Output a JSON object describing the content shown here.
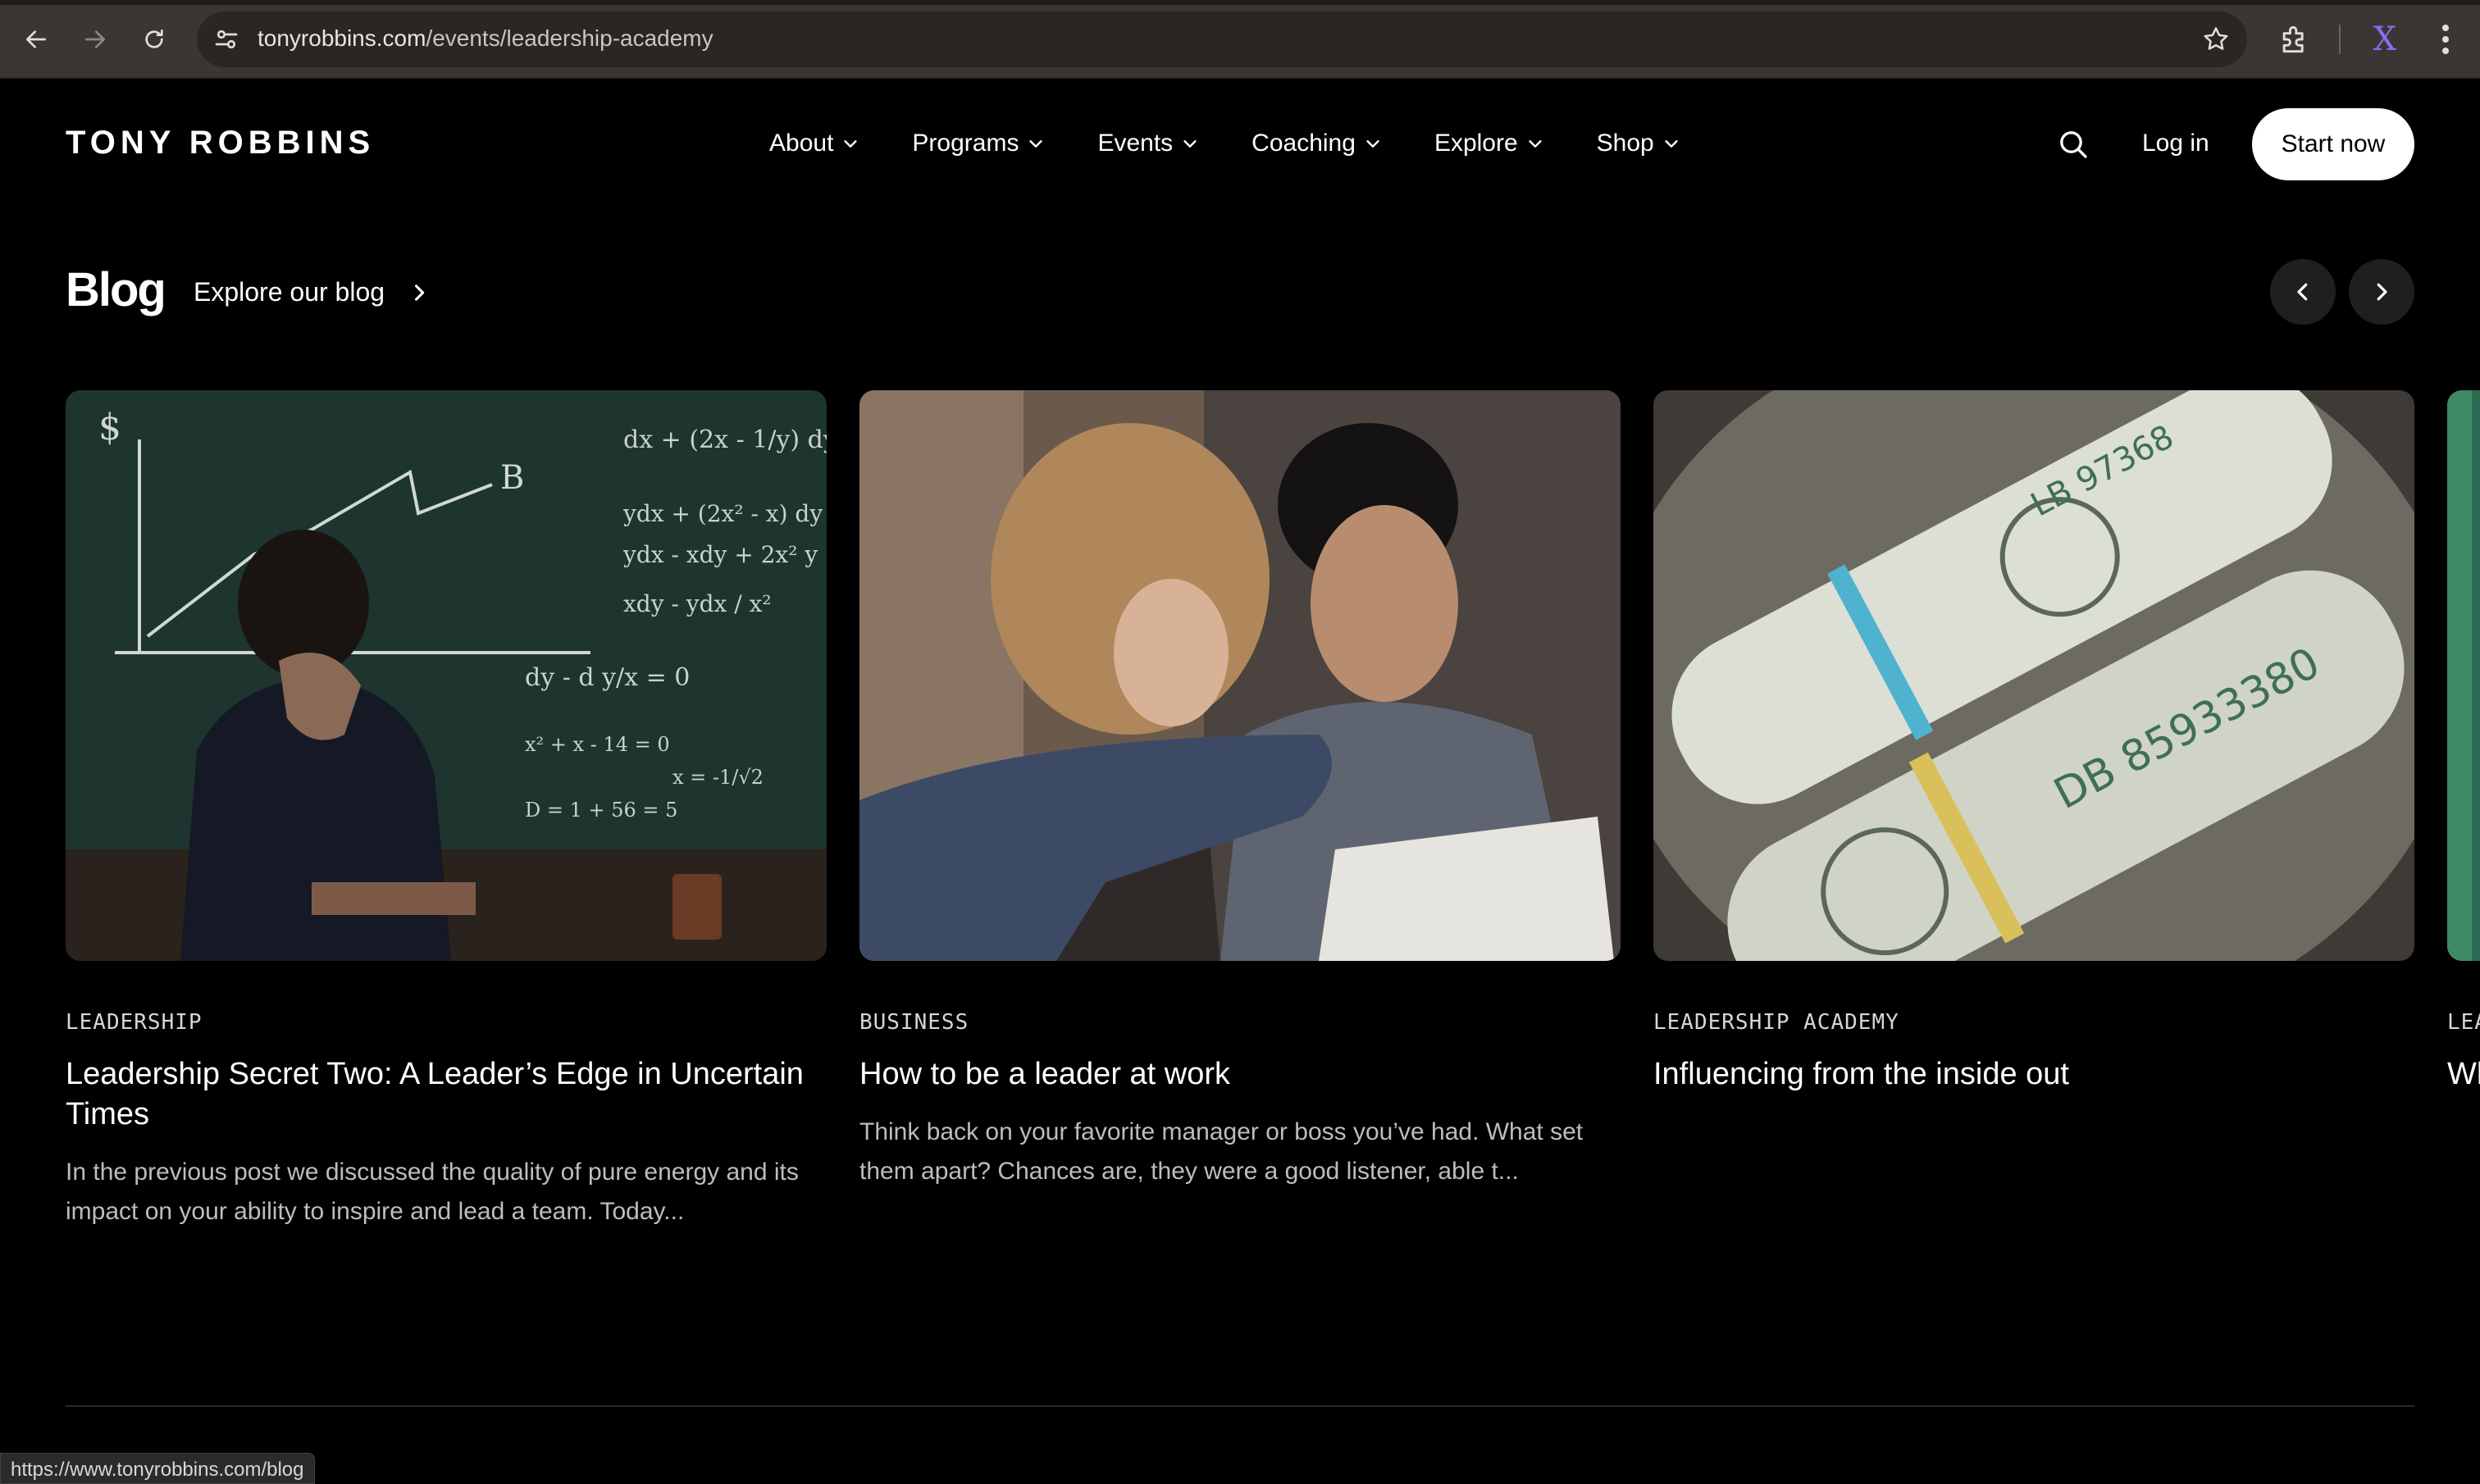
{
  "browser": {
    "url_domain": "tonyrobbins.com",
    "url_path": "/events/leadership-academy",
    "profile_initial": "X",
    "status_url": "https://www.tonyrobbins.com/blog"
  },
  "site": {
    "logo": "TONY ROBBINS",
    "nav": [
      {
        "label": "About"
      },
      {
        "label": "Programs"
      },
      {
        "label": "Events"
      },
      {
        "label": "Coaching"
      },
      {
        "label": "Explore"
      },
      {
        "label": "Shop"
      }
    ],
    "login": "Log in",
    "start": "Start now"
  },
  "blog": {
    "title": "Blog",
    "explore": "Explore our blog",
    "cards": [
      {
        "category": "LEADERSHIP",
        "title": "Leadership Secret Two: A Leader’s Edge in Uncertain Times",
        "excerpt": "In the previous post we discussed the quality of pure energy and its impact on your ability to inspire and lead a team. Today..."
      },
      {
        "category": "BUSINESS",
        "title": "How to be a leader at work",
        "excerpt": "Think back on your favorite manager or boss you’ve had. What set them apart? Chances are, they were a good listener, able t..."
      },
      {
        "category": "LEADERSHIP ACADEMY",
        "title": "Influencing from the inside out",
        "excerpt": ""
      },
      {
        "category": "LEA",
        "title": "Wh",
        "excerpt": ""
      }
    ]
  }
}
